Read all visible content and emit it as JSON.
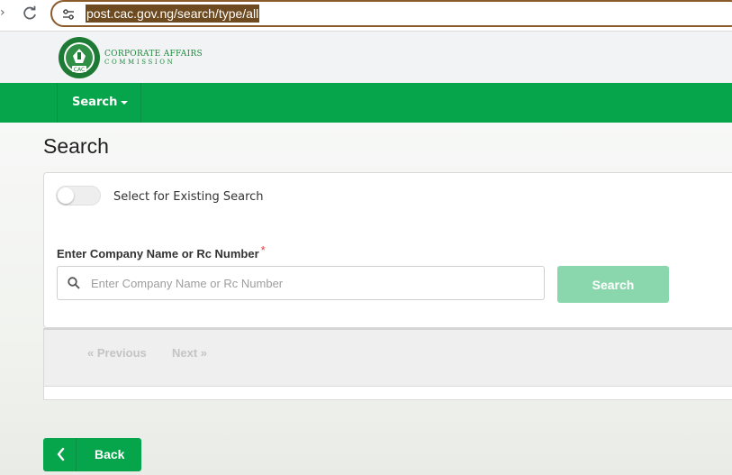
{
  "browser": {
    "url": "post.cac.gov.ng/search/type/all"
  },
  "header": {
    "logo_text_line1": "CORPORATE AFFAIRS",
    "logo_text_line2": "COMMISSION",
    "seal_text": "CAC",
    "brand_color": "#06a54b"
  },
  "nav": {
    "search_label": "Search"
  },
  "main": {
    "page_title": "Search",
    "toggle_label": "Select for Existing Search",
    "toggle_on": false,
    "field_label": "Enter Company Name or Rc Number",
    "required_mark": "*",
    "search_placeholder": "Enter Company Name or Rc Number",
    "search_value": "",
    "search_button_label": "Search"
  },
  "pagination": {
    "previous_label": "«  Previous",
    "next_label": "Next  »"
  },
  "footer": {
    "back_label": "Back"
  }
}
